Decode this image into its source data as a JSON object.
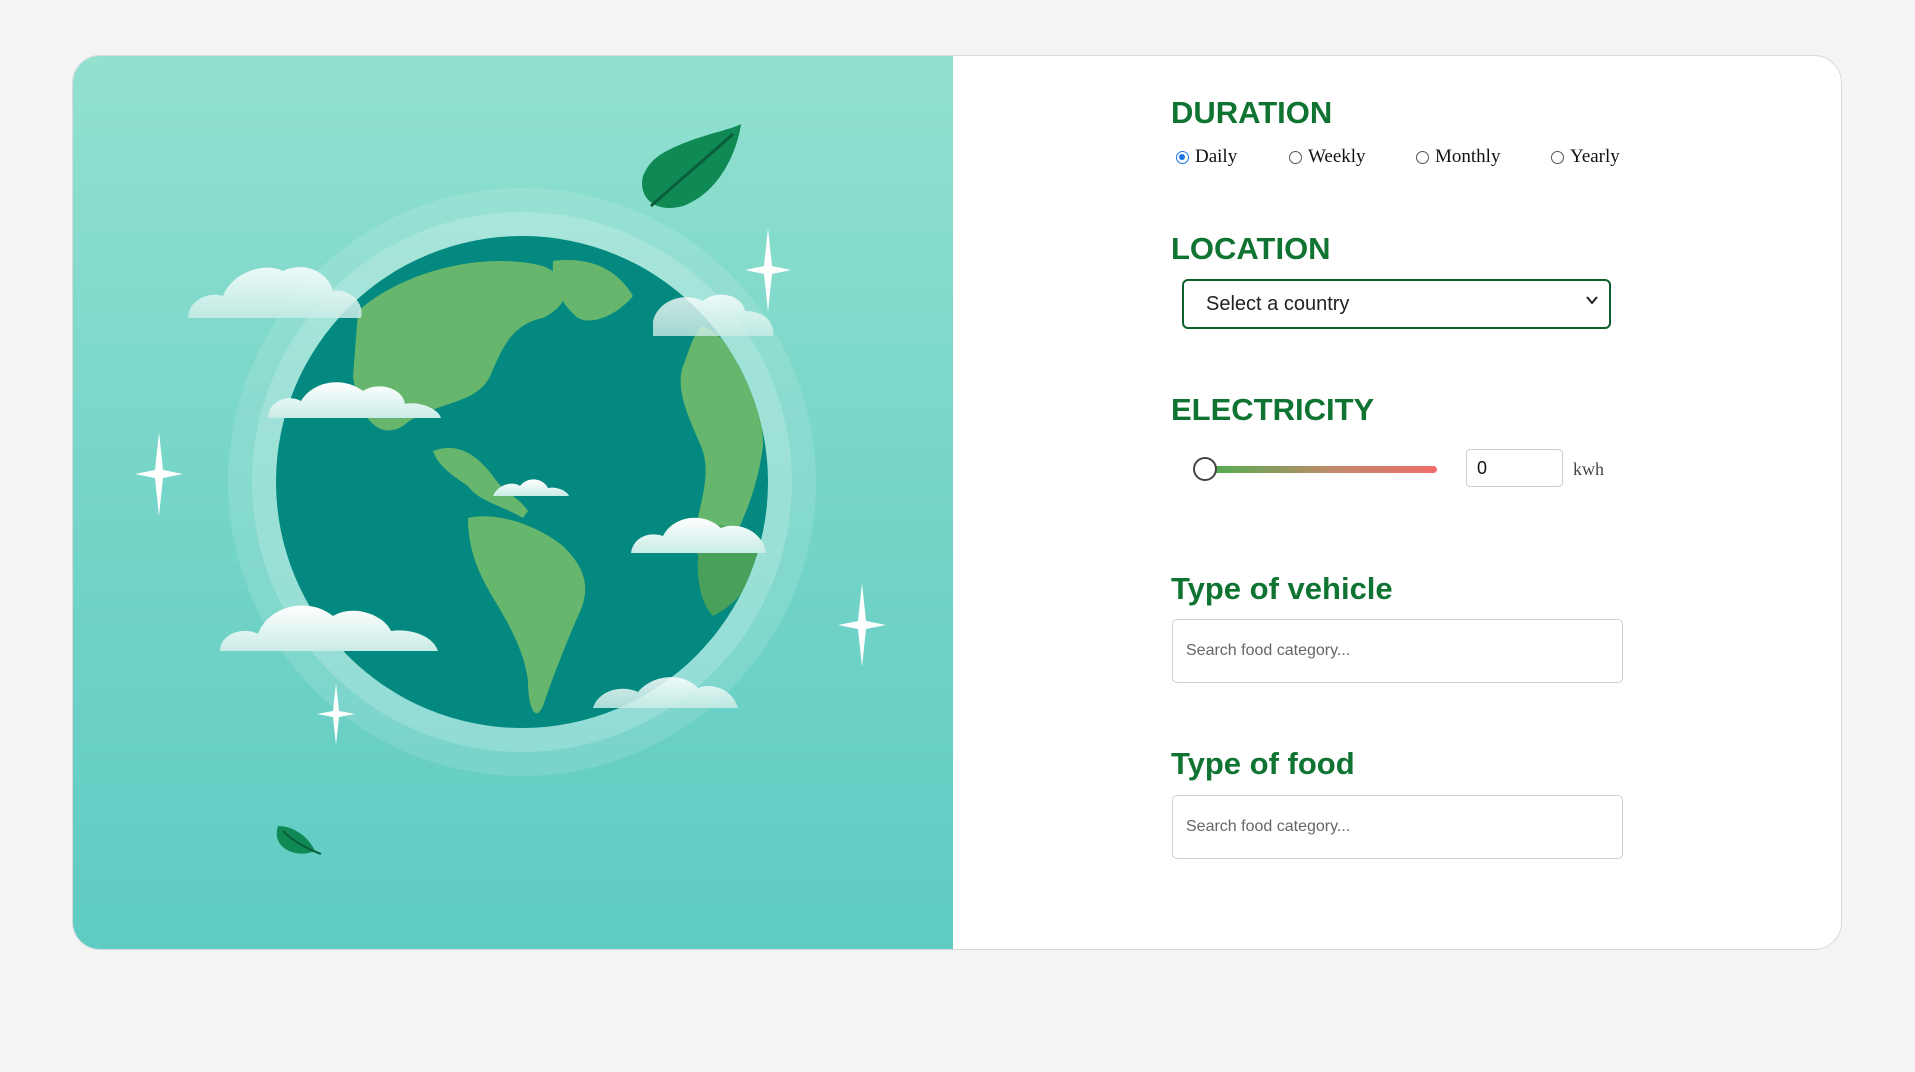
{
  "duration": {
    "title": "DURATION",
    "options": [
      {
        "label": "Daily",
        "checked": true
      },
      {
        "label": "Weekly",
        "checked": false
      },
      {
        "label": "Monthly",
        "checked": false
      },
      {
        "label": "Yearly",
        "checked": false
      }
    ]
  },
  "location": {
    "title": "LOCATION",
    "selected": "Select a country"
  },
  "electricity": {
    "title": "ELECTRICITY",
    "slider_value": 0,
    "value": "0",
    "unit": "kwh",
    "track_colors": [
      "#4caf50",
      "#f06b6b"
    ]
  },
  "vehicle": {
    "title": "Type of vehicle",
    "placeholder": "Search food category..."
  },
  "food": {
    "title": "Type of food",
    "placeholder": "Search food category..."
  },
  "colors": {
    "accent": "#0f7432",
    "hero_top": "#92e1cf",
    "hero_bottom": "#5fcbc3",
    "radio_checked": "#1a73e8"
  },
  "icons": {
    "hero": "earth-illustration",
    "leaf": "leaf-icon",
    "sparkle": "sparkle-icon",
    "select_arrow": "chevron-down-icon"
  }
}
